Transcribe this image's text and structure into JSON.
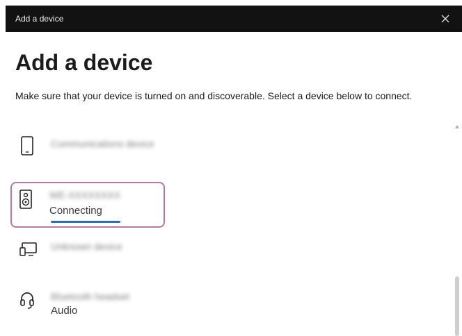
{
  "window": {
    "title": "Add a device",
    "close_icon": "close-icon"
  },
  "page": {
    "heading": "Add a device",
    "description": "Make sure that your device is turned on and discoverable. Select a device below to connect."
  },
  "devices": [
    {
      "icon": "phone-icon",
      "name": "Communications device",
      "status": ""
    },
    {
      "icon": "speaker-icon",
      "name": "WE-XXXXXXXX",
      "status": "Connecting",
      "selected": true,
      "progress": "indeterminate"
    },
    {
      "icon": "display-icon",
      "name": "Unknown device",
      "status": ""
    },
    {
      "icon": "headset-icon",
      "name": "Bluetooth headset",
      "status": "Audio"
    }
  ],
  "colors": {
    "titlebar": "#121212",
    "selection_outline": "#b27aa7",
    "progress": "#2d6fb3"
  }
}
